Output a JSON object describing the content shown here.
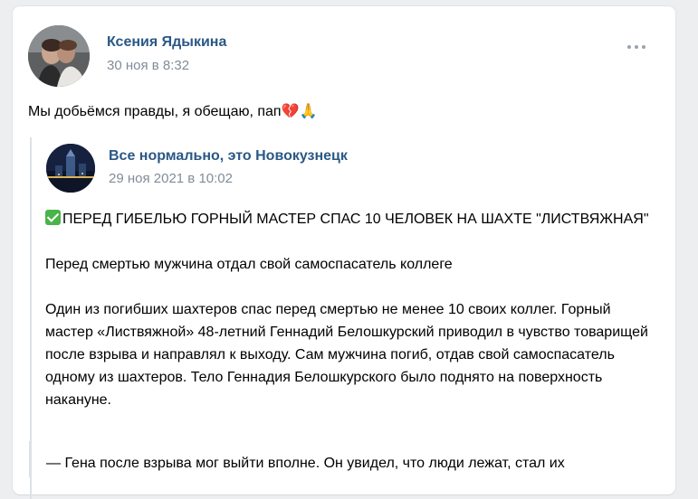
{
  "post": {
    "author": "Ксения Ядыкина",
    "date": "30 ноя в 8:32",
    "text": "Мы добьёмся правды, я обещаю, пап💔🙏",
    "more_icon": "more-horizontal-icon"
  },
  "repost": {
    "author": "Все нормально, это Новокузнецк",
    "date": "29 ноя 2021 в 10:02",
    "check_icon": "check-mark-icon",
    "headline": "ПЕРЕД ГИБЕЛЬЮ ГОРНЫЙ МАСТЕР СПАС 10 ЧЕЛОВЕК НА ШАХТЕ \"ЛИСТВЯЖНАЯ\"",
    "subtitle": "Перед смертью мужчина отдал свой самоспасатель коллеге",
    "paragraph": "Один из погибших шахтеров спас перед смертью не менее 10 своих коллег. Горный мастер «Листвяжной» 48-летний Геннадий Белошкурский приводил в чувство товарищей после взрыва и направлял к выходу. Сам мужчина погиб, отдав свой самоспасатель одному из шахтеров. Тело Геннадия Белошкурского было поднято на поверхность накануне.",
    "cutoff": "— Гена после взрыва мог выйти вполне. Он увидел, что люди лежат, стал их"
  },
  "colors": {
    "link": "#2a5885",
    "secondary": "#818c99",
    "background": "#edeef0",
    "check": "#4ab34a"
  }
}
